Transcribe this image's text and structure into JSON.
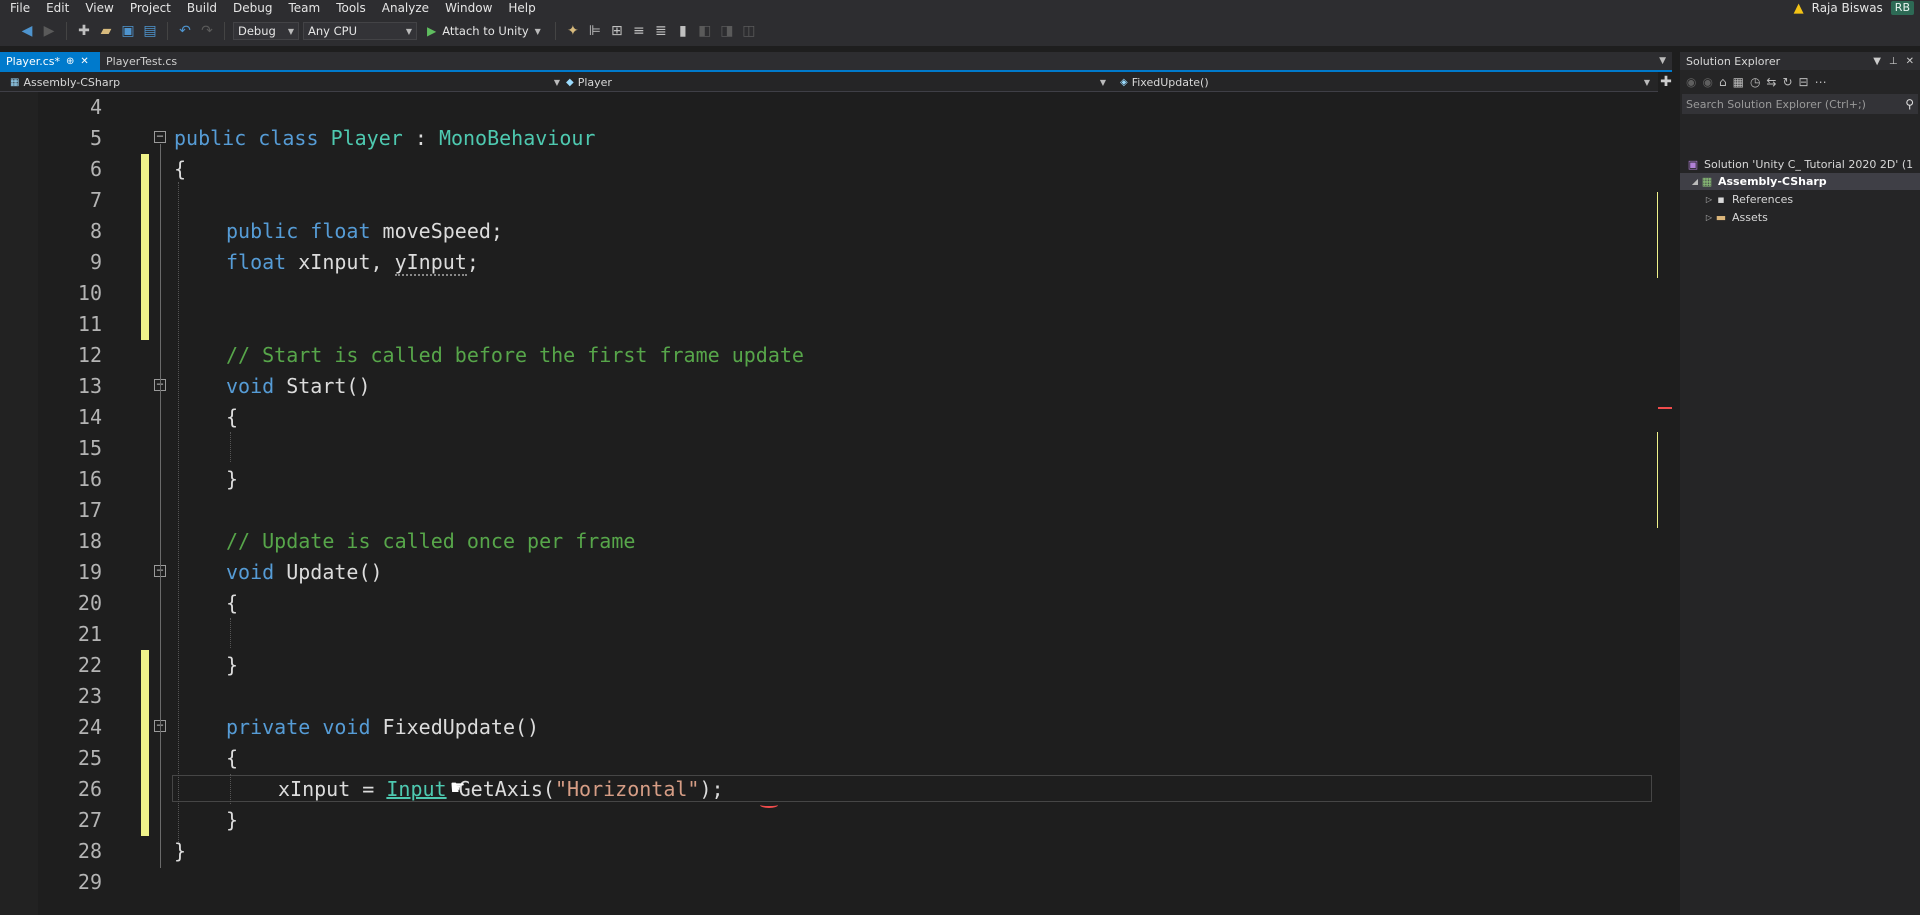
{
  "menu": [
    "File",
    "Edit",
    "View",
    "Project",
    "Build",
    "Debug",
    "Team",
    "Tools",
    "Analyze",
    "Window",
    "Help"
  ],
  "user": {
    "name": "Raja Biswas",
    "initials": "RB"
  },
  "toolbar": {
    "configuration": "Debug",
    "platform": "Any CPU",
    "attach_label": "Attach to Unity"
  },
  "tabs": [
    {
      "label": "Player.cs*",
      "active": true
    },
    {
      "label": "PlayerTest.cs",
      "active": false
    }
  ],
  "nav": {
    "project": "Assembly-CSharp",
    "class": "Player",
    "member": "FixedUpdate()"
  },
  "code_lines": [
    {
      "n": "4"
    },
    {
      "n": "5"
    },
    {
      "n": "6"
    },
    {
      "n": "7"
    },
    {
      "n": "8"
    },
    {
      "n": "9"
    },
    {
      "n": "10"
    },
    {
      "n": "11"
    },
    {
      "n": "12"
    },
    {
      "n": "13"
    },
    {
      "n": "14"
    },
    {
      "n": "15"
    },
    {
      "n": "16"
    },
    {
      "n": "17"
    },
    {
      "n": "18"
    },
    {
      "n": "19"
    },
    {
      "n": "20"
    },
    {
      "n": "21"
    },
    {
      "n": "22"
    },
    {
      "n": "23"
    },
    {
      "n": "24"
    },
    {
      "n": "25"
    },
    {
      "n": "26"
    },
    {
      "n": "27"
    },
    {
      "n": "28"
    },
    {
      "n": "29"
    }
  ],
  "code": {
    "l5_public": "public",
    "l5_class": "class",
    "l5_name": "Player",
    "l5_colon": " : ",
    "l5_base": "MonoBehaviour",
    "open_brace": "{",
    "close_brace": "}",
    "l8_public": "public",
    "l8_float": "float",
    "l8_rest": " moveSpeed;",
    "l9_float": "float",
    "l9_a": " xInput, ",
    "l9_y": "yInput",
    "l9_semi": ";",
    "l12_comment": "// Start is called before the first frame update",
    "l13_void": "void",
    "l13_rest": " Start()",
    "l18_comment": "// Update is called once per frame",
    "l19_void": "void",
    "l19_rest": " Update()",
    "l24_private": "private",
    "l24_void": "void",
    "l24_rest": " FixedUpdate()",
    "l26_a": "xInput = ",
    "l26_input": "Input",
    "l26_b": " GetAxis(",
    "l26_str": "\"Horizontal\"",
    "l26_c": ");"
  },
  "solution_explorer": {
    "title": "Solution Explorer",
    "search_placeholder": "Search Solution Explorer (Ctrl+;)",
    "solution": "Solution 'Unity C_ Tutorial 2020 2D' (1",
    "project": "Assembly-CSharp",
    "references": "References",
    "assets": "Assets"
  }
}
